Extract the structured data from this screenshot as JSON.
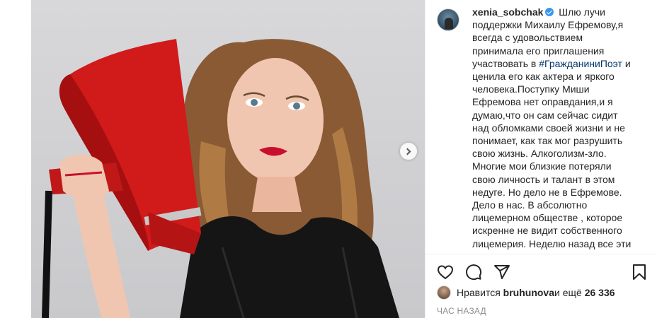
{
  "post": {
    "media": {
      "next_icon": "chevron-right-icon"
    },
    "caption": {
      "username": "xenia_sobchak",
      "lines": [
        "Шлю лучи",
        "поддержки Михаилу Ефремову,я",
        "всегда с удовольствием",
        "принимала его приглашения",
        "участвовать в",
        "ценила его как актера и яркого",
        "человека.Поступку Миши",
        "Ефремова нет оправдания,и я",
        "думаю,что он сам сейчас сидит",
        "над обломками своей жизни и не",
        "понимает, как так мог разрушить",
        "свою жизнь. Алкоголизм-зло.",
        "Многие мои близкие потеряли",
        "свою личность и талант в этом",
        "недуге. Но дело не в Ефремове.",
        "Дело в нас. В абсолютно",
        "лицемерном обществе , которое",
        "искренне не видит собственного",
        "лицемерия. Неделю назад все эти"
      ],
      "hashtag": "#ГражданиниПоэт",
      "after_hashtag": " и"
    },
    "actions": {
      "like_icon": "heart-icon",
      "comment_icon": "comment-icon",
      "share_icon": "share-icon",
      "save_icon": "bookmark-icon"
    },
    "likes": {
      "prefix": "Нравится ",
      "user": "bruhunova",
      "middle": " и ещё ",
      "count": "26 336"
    },
    "time_ago": "ЧАС НАЗАД",
    "colors": {
      "link": "#00376b",
      "verified": "#3897f0",
      "muted": "#8e8e8e",
      "megaphone": "#d11a1a"
    }
  }
}
